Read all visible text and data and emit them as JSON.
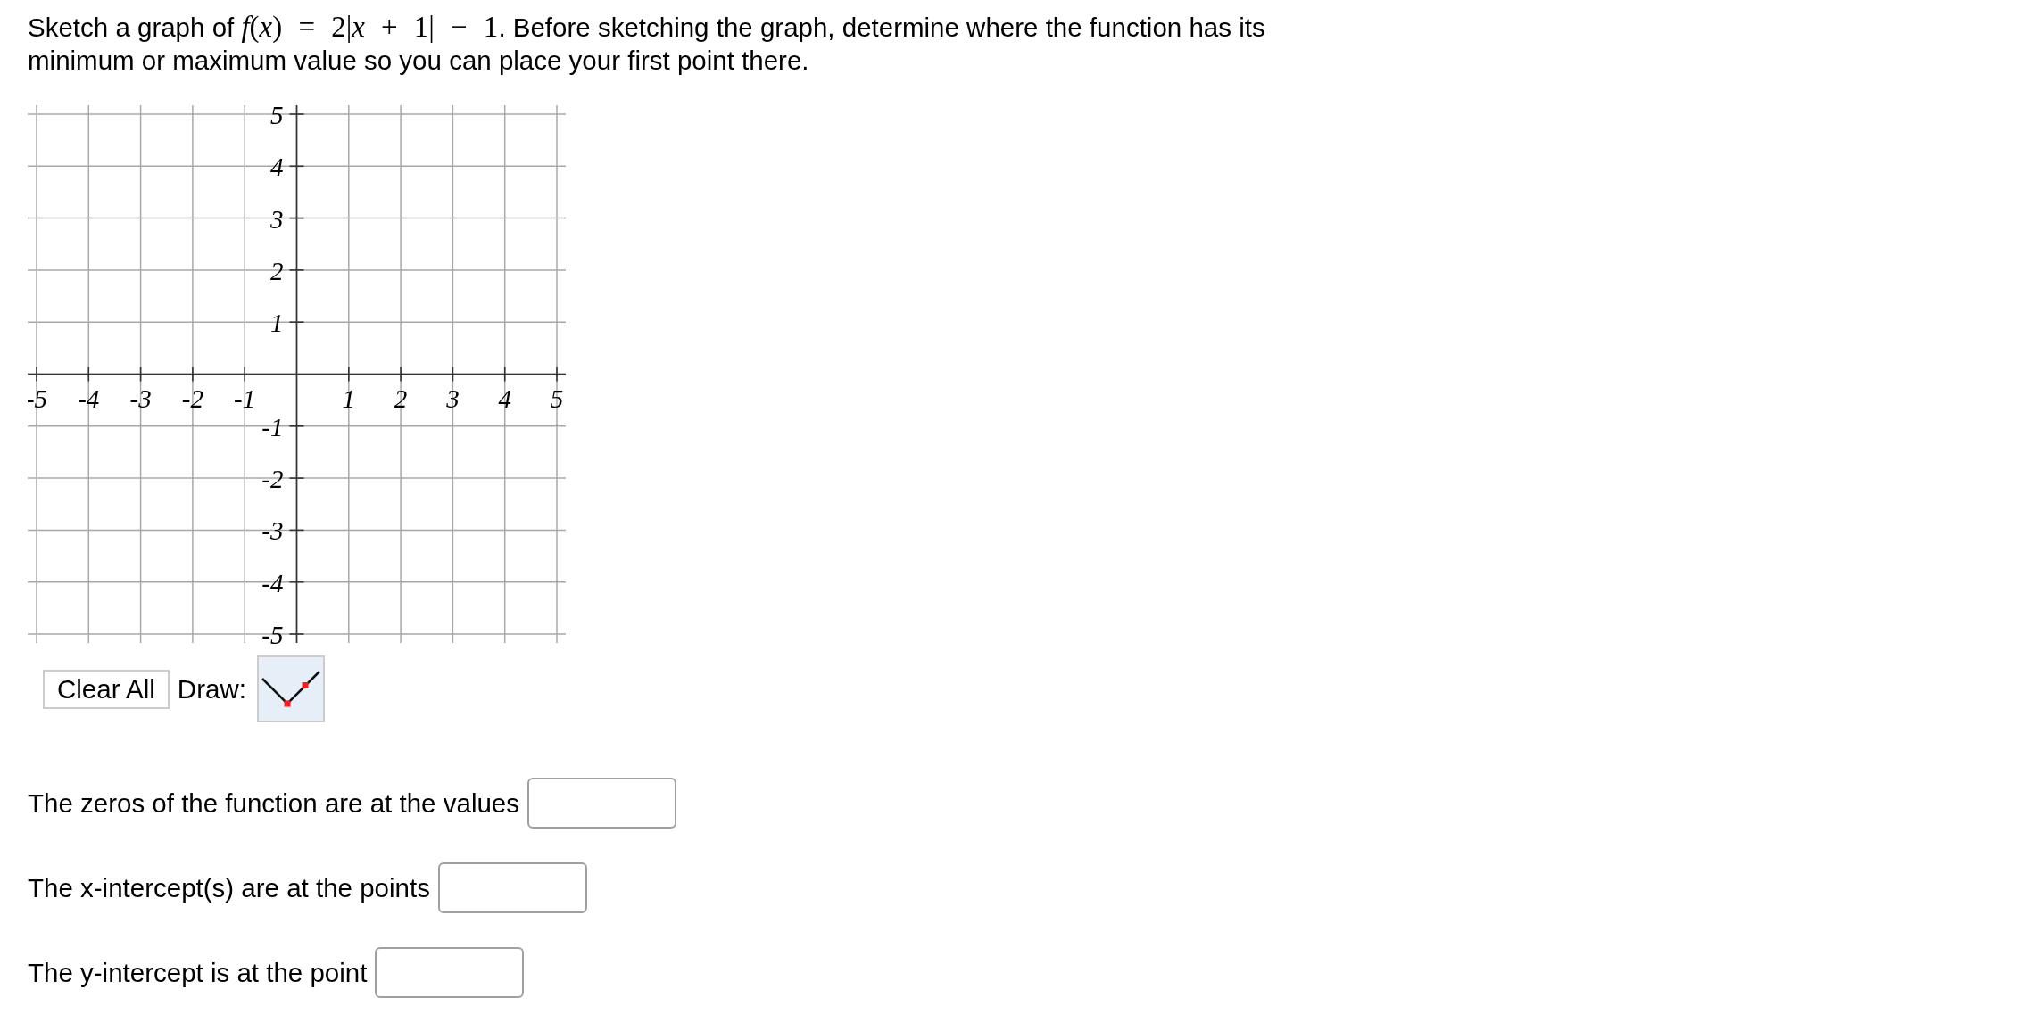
{
  "prompt": {
    "lead": "Sketch a graph of",
    "formula": "*f*(*x*) = 2|*x* + 1| − 1",
    "rest": ". Before sketching the graph, determine where the function has its minimum or maximum value so you can place your first point there."
  },
  "graph": {
    "chart_data": {
      "type": "line",
      "grid": true,
      "xlim": [
        -5,
        5
      ],
      "ylim": [
        -5,
        5
      ],
      "xticks": [
        -5,
        -4,
        -3,
        -2,
        -1,
        1,
        2,
        3,
        4,
        5
      ],
      "yticks": [
        5,
        4,
        3,
        2,
        1,
        -1,
        -2,
        -3,
        -4,
        -5
      ]
    }
  },
  "controls": {
    "clear_button": "Clear All",
    "draw_label": "Draw:",
    "draw_tools": [
      {
        "kind": "absolute_value",
        "selected": true
      }
    ]
  },
  "answers": [
    {
      "label": "The zeros of the function are at the values"
    },
    {
      "label": "The x-intercept(s) are at the points"
    },
    {
      "label": "The y-intercept is at the point"
    }
  ]
}
